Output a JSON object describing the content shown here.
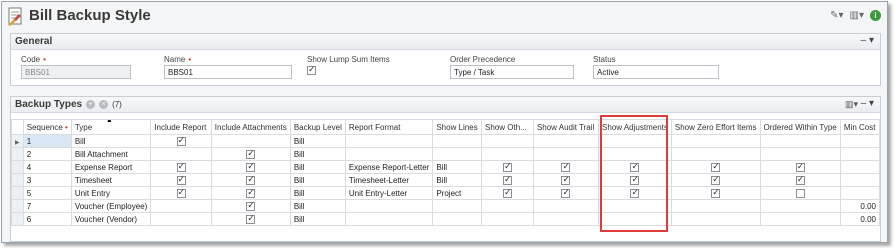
{
  "header": {
    "title": "Bill Backup Style"
  },
  "general": {
    "title": "General",
    "collapse": "– ▾",
    "code": {
      "label": "Code",
      "value": "BBS01"
    },
    "name": {
      "label": "Name",
      "value": "BBS01"
    },
    "show_lump_sum": {
      "label": "Show Lump Sum Items",
      "checked": true
    },
    "order_precedence": {
      "label": "Order Precedence",
      "value": "Type / Task"
    },
    "status": {
      "label": "Status",
      "value": "Active"
    }
  },
  "backup_types": {
    "title": "Backup Types",
    "count": "(7)",
    "collapse": "– ▾",
    "columns": [
      "Sequence",
      "Type",
      "Include Report",
      "Include Attachments",
      "Backup Level",
      "Report Format",
      "Show Lines",
      "Show Oth...",
      "Show Audit Trail",
      "Show Adjustments",
      "Show Zero Effort Items",
      "Ordered Within Type",
      "Min Cost"
    ],
    "rows": [
      {
        "seq": "1",
        "type": "Bill",
        "include_report": true,
        "include_attach": false,
        "level": "Bill",
        "format": "",
        "lines": "",
        "other": false,
        "audit": false,
        "adjust": false,
        "zero": false,
        "ordered": false,
        "min": ""
      },
      {
        "seq": "2",
        "type": "Bill Attachment",
        "include_report": false,
        "include_attach": true,
        "level": "Bill",
        "format": "",
        "lines": "",
        "other": false,
        "audit": false,
        "adjust": false,
        "zero": false,
        "ordered": false,
        "min": ""
      },
      {
        "seq": "4",
        "type": "Expense Report",
        "include_report": true,
        "include_attach": true,
        "level": "Bill",
        "format": "Expense Report-Letter",
        "lines": "Bill",
        "other": true,
        "audit": true,
        "adjust": true,
        "zero": true,
        "ordered": true,
        "min": ""
      },
      {
        "seq": "3",
        "type": "Timesheet",
        "include_report": true,
        "include_attach": true,
        "level": "Bill",
        "format": "Timesheet-Letter",
        "lines": "Bill",
        "other": true,
        "audit": true,
        "adjust": true,
        "zero": true,
        "ordered": true,
        "min": ""
      },
      {
        "seq": "5",
        "type": "Unit Entry",
        "include_report": true,
        "include_attach": true,
        "level": "Bill",
        "format": "Unit Entry-Letter",
        "lines": "Project",
        "other": true,
        "audit": true,
        "adjust": true,
        "zero": true,
        "ordered": "empty",
        "min": ""
      },
      {
        "seq": "7",
        "type": "Voucher (Employee)",
        "include_report": false,
        "include_attach": true,
        "level": "Bill",
        "format": "",
        "lines": "",
        "other": false,
        "audit": false,
        "adjust": false,
        "zero": false,
        "ordered": false,
        "min": "0.00"
      },
      {
        "seq": "6",
        "type": "Voucher (Vendor)",
        "include_report": false,
        "include_attach": true,
        "level": "Bill",
        "format": "",
        "lines": "",
        "other": false,
        "audit": false,
        "adjust": false,
        "zero": false,
        "ordered": false,
        "min": "0.00"
      }
    ]
  },
  "colors": {
    "highlight": "#e03a3a",
    "required": "#dd2222",
    "info": "#3b9a3b"
  }
}
